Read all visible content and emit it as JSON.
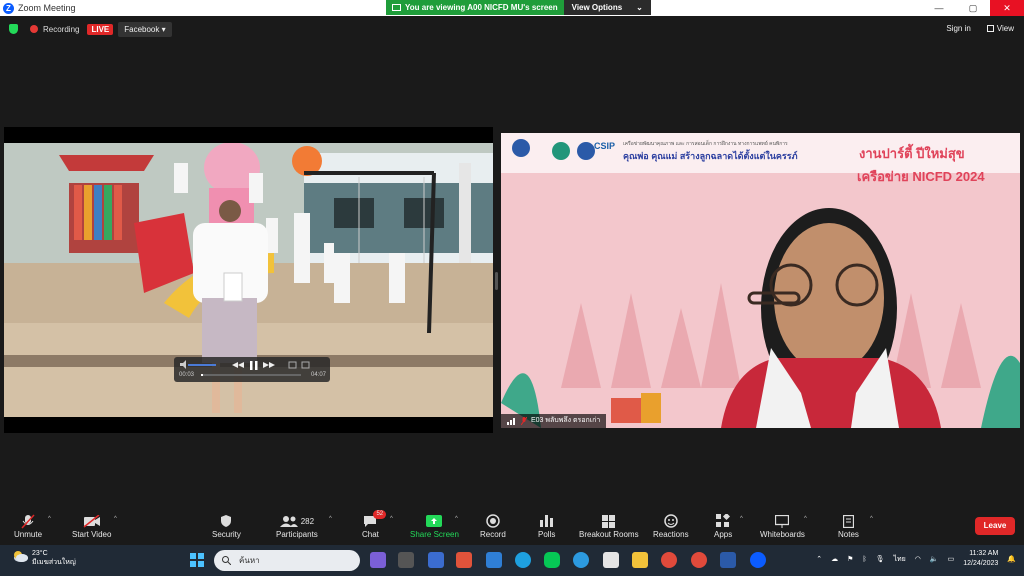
{
  "titlebar": {
    "title": "Zoom Meeting",
    "logo": "Z",
    "minimize": "—",
    "restore": "▢",
    "close": "✕"
  },
  "viewing_banner": {
    "text": "You are viewing A00 NICFD MU's screen",
    "options": "View Options",
    "options_caret": "⌄"
  },
  "topbar": {
    "recording": "Recording",
    "live": "LIVE",
    "facebook": "Facebook ▾",
    "sign_in": "Sign in",
    "view": "View"
  },
  "video_controls": {
    "current": "00:03",
    "duration": "04:07"
  },
  "right_tile": {
    "banner_line1": "เครือข่ายพัฒนาคุณภาพ และ การสอนเด็ก การฝึกงาน ทางการแพทย์ คนพิการ",
    "banner_line2": "คุณพ่อ คุณแม่ สร้างลูกฉลาดได้ตั้งแต่ในครรภ์",
    "party_title": "งานปาร์ตี้ ปีใหม่สุข",
    "network_title": "เครือข่าย NICFD 2024",
    "csip_logo": "CSIP",
    "participant_name": "E03 พลับพลึง ตรอกเก่า"
  },
  "toolbar": {
    "unmute": "Unmute",
    "start_video": "Start Video",
    "security": "Security",
    "participants": "Participants",
    "participants_count": "282",
    "chat": "Chat",
    "chat_badge": "52",
    "share_screen": "Share Screen",
    "record": "Record",
    "polls": "Polls",
    "breakout_rooms": "Breakout Rooms",
    "reactions": "Reactions",
    "apps": "Apps",
    "whiteboards": "Whiteboards",
    "notes": "Notes",
    "leave": "Leave"
  },
  "taskbar": {
    "temperature": "23°C",
    "weather_desc": "มีเมฆส่วนใหญ่",
    "search_placeholder": "ค้นหา",
    "language": "ไทย",
    "time": "11:32 AM",
    "date": "12/24/2023"
  },
  "colors": {
    "live": "#e02828",
    "leave": "#e02828",
    "share": "#23d959",
    "banner_green": "#1f9d3a",
    "accent_blue": "#0b5cff"
  }
}
